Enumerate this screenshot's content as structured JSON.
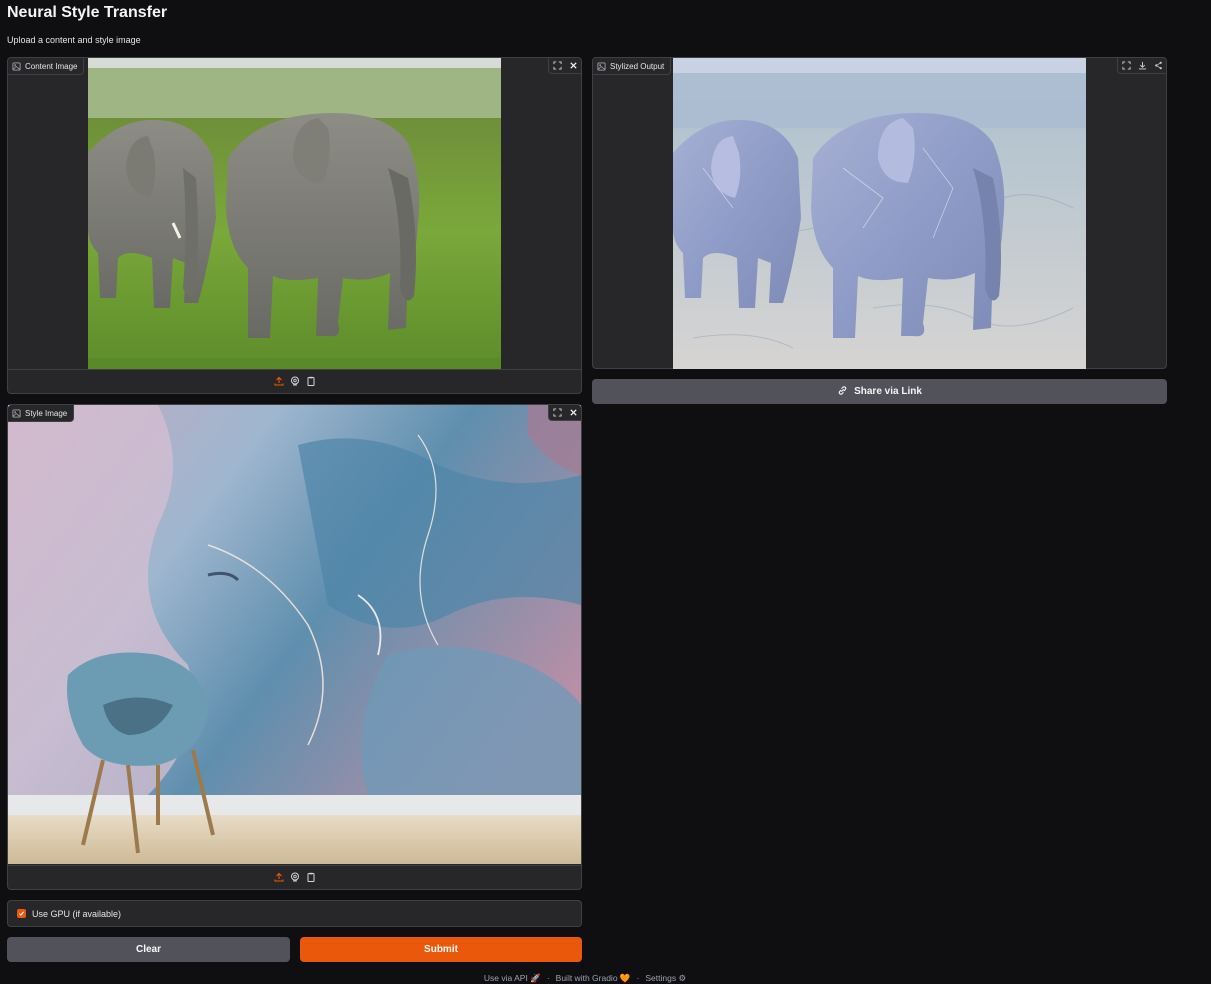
{
  "page": {
    "title": "Neural Style Transfer",
    "subtitle": "Upload a content and style image"
  },
  "content_panel": {
    "label": "Content Image",
    "icons": [
      "fullscreen-icon",
      "close-icon"
    ],
    "bottom_icons": [
      "upload-icon",
      "webcam-icon",
      "clipboard-icon"
    ]
  },
  "output_panel": {
    "label": "Stylized Output",
    "icons": [
      "fullscreen-icon",
      "download-icon",
      "share-icon"
    ]
  },
  "style_panel": {
    "label": "Style Image",
    "icons": [
      "fullscreen-icon",
      "close-icon"
    ],
    "bottom_icons": [
      "upload-icon",
      "webcam-icon",
      "clipboard-icon"
    ]
  },
  "share_button": {
    "label": "Share via Link"
  },
  "gpu_checkbox": {
    "label": "Use GPU (if available)",
    "checked": true
  },
  "buttons": {
    "clear": "Clear",
    "submit": "Submit"
  },
  "footer": {
    "api": "Use via API",
    "built": "Built with Gradio",
    "settings": "Settings",
    "separator": "·"
  },
  "colors": {
    "background": "#0f0f11",
    "panel": "#27272a",
    "accent": "#ea580c",
    "secondary_button": "#52525b"
  }
}
